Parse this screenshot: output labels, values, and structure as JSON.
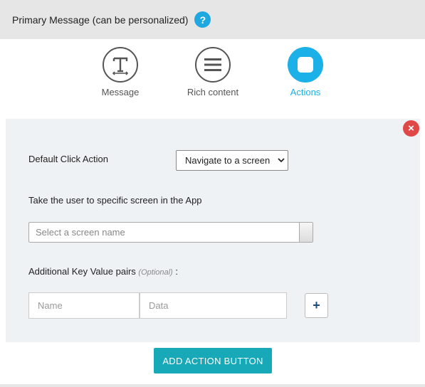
{
  "header": {
    "title": "Primary Message (can be personalized)",
    "help_icon": "?"
  },
  "tabs": [
    {
      "label": "Message",
      "icon": "text-T-icon",
      "active": false
    },
    {
      "label": "Rich content",
      "icon": "list-lines-icon",
      "active": false
    },
    {
      "label": "Actions",
      "icon": "square-icon",
      "active": true
    }
  ],
  "panel": {
    "close_icon": "×",
    "default_click_label": "Default Click Action",
    "default_click_value": "Navigate to a screen",
    "screen_label": "Take the user to specific screen in the App",
    "screen_placeholder": "Select a screen name",
    "kv_label": "Additional Key Value pairs",
    "kv_optional": "(Optional)",
    "kv_colon": ":",
    "name_placeholder": "Name",
    "data_placeholder": "Data",
    "plus_symbol": "+"
  },
  "add_action_button": "ADD ACTION BUTTON",
  "colors": {
    "accent": "#1cb0e8",
    "button": "#17a9b7",
    "close": "#e04848",
    "panel_bg": "#eff2f4"
  }
}
